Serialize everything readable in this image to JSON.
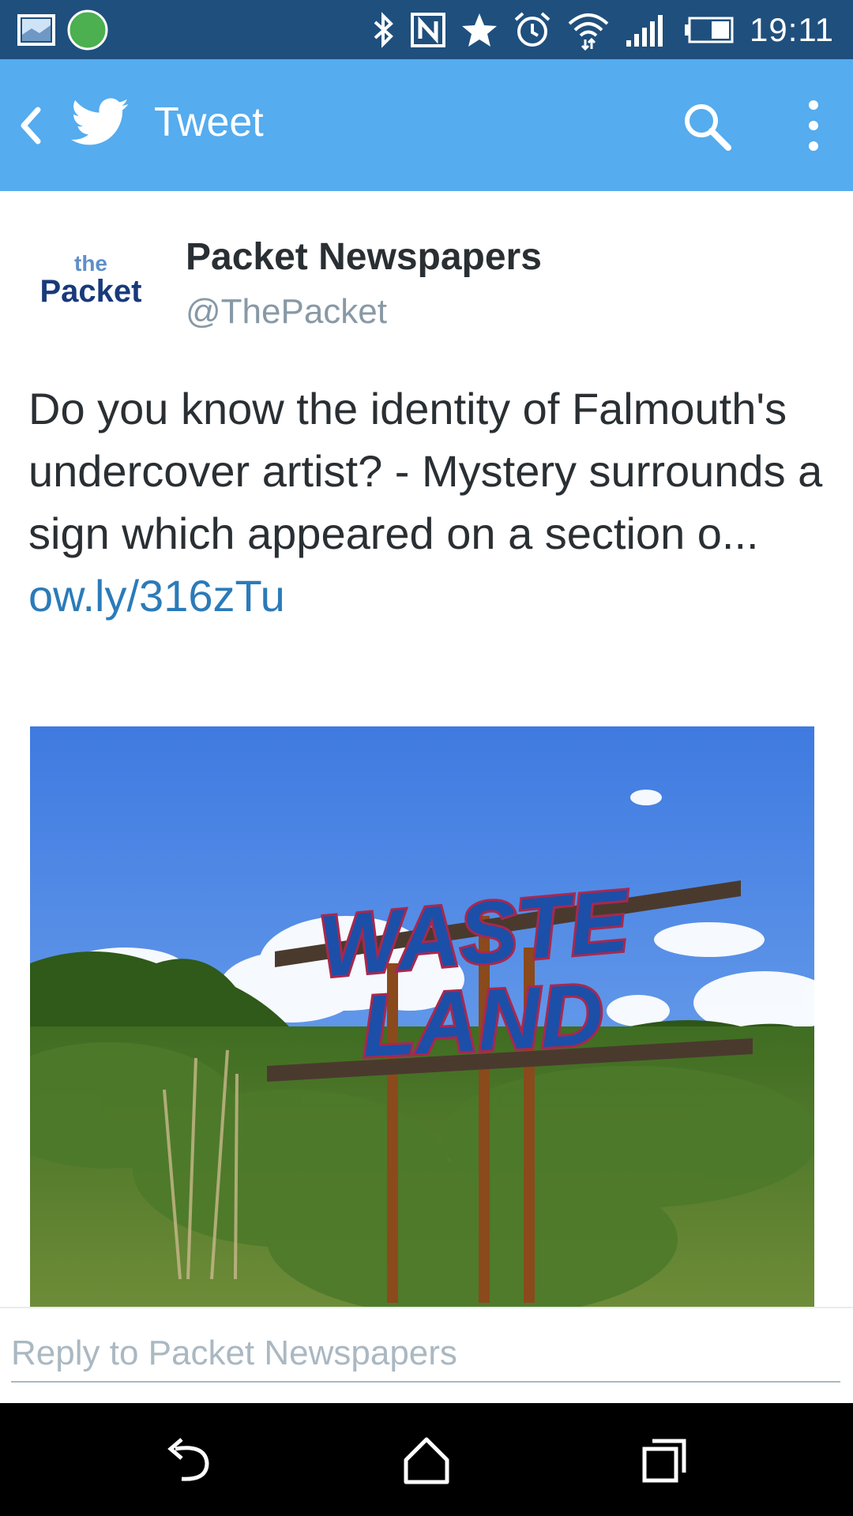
{
  "status_bar": {
    "time": "19:11",
    "icons": [
      "image-icon",
      "green-dot-icon",
      "bluetooth-icon",
      "nfc-icon",
      "star-icon",
      "alarm-icon",
      "wifi-icon",
      "signal-icon",
      "battery-icon"
    ]
  },
  "app_bar": {
    "title": "Tweet",
    "icons": [
      "back-icon",
      "twitter-bird-icon",
      "search-icon",
      "more-icon"
    ]
  },
  "tweet": {
    "avatar_line1": "the",
    "avatar_line2": "Packet",
    "author_name": "Packet Newspapers",
    "author_handle": "@ThePacket",
    "text": "Do you know the identity of Falmouth's undercover artist? - Mystery surrounds a sign which appeared on a section o... ",
    "link_text": "ow.ly/316zTu",
    "image_sign_line1": "WASTE",
    "image_sign_line2": "LAND"
  },
  "reply": {
    "placeholder": "Reply to Packet Newspapers"
  },
  "nav_bar": {
    "icons": [
      "back-nav-icon",
      "home-nav-icon",
      "recents-nav-icon"
    ]
  },
  "colors": {
    "status_bar": "#1f4f7d",
    "app_bar": "#55acee",
    "link": "#2b7bb9",
    "text": "#292f33",
    "muted": "#8899a6"
  }
}
